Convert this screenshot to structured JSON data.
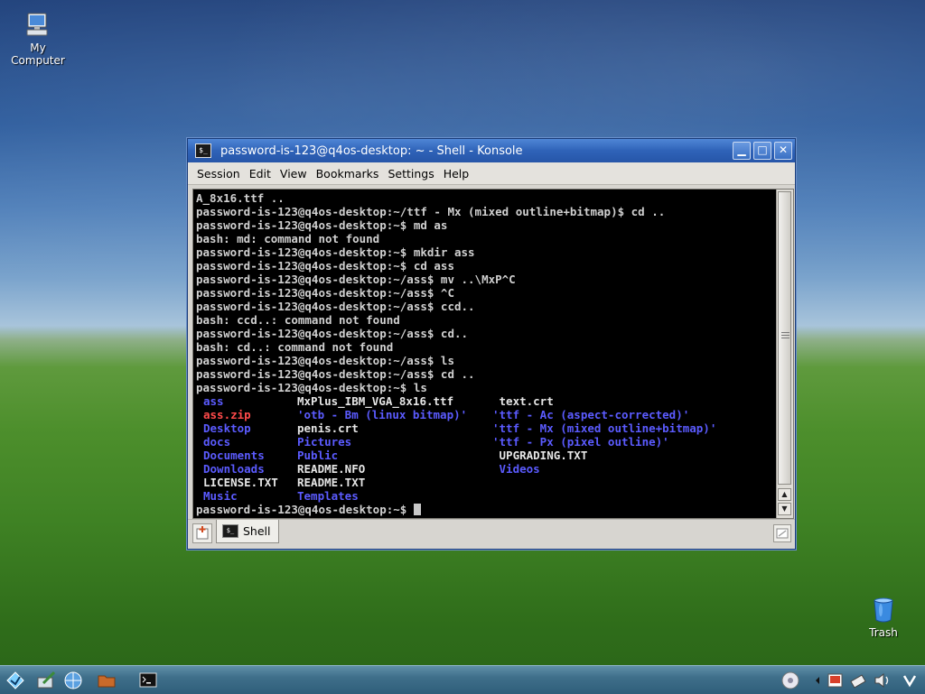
{
  "desktop": {
    "icons": [
      {
        "label_line1": "My",
        "label_line2": "Computer",
        "icon": "computer-icon"
      },
      {
        "label": "Trash",
        "icon": "trash-icon"
      }
    ]
  },
  "window": {
    "title": "password-is-123@q4os-desktop: ~ - Shell - Konsole",
    "buttons": {
      "minimize": "▁",
      "maximize": "□",
      "close": "✕"
    },
    "menu": [
      "Session",
      "Edit",
      "View",
      "Bookmarks",
      "Settings",
      "Help"
    ]
  },
  "terminal": {
    "lines": [
      "A_8x16.ttf ..",
      "password-is-123@q4os-desktop:~/ttf - Mx (mixed outline+bitmap)$ cd ..",
      "password-is-123@q4os-desktop:~$ md as",
      "bash: md: command not found",
      "password-is-123@q4os-desktop:~$ mkdir ass",
      "password-is-123@q4os-desktop:~$ cd ass",
      "password-is-123@q4os-desktop:~/ass$ mv ..\\MxP^C",
      "password-is-123@q4os-desktop:~/ass$ ^C",
      "password-is-123@q4os-desktop:~/ass$ ccd..",
      "bash: ccd..: command not found",
      "password-is-123@q4os-desktop:~/ass$ cd..",
      "bash: cd..: command not found",
      "password-is-123@q4os-desktop:~/ass$ ls",
      "password-is-123@q4os-desktop:~/ass$ cd ..",
      "password-is-123@q4os-desktop:~$ ls"
    ],
    "ls_rows": [
      [
        {
          "t": "ass",
          "c": "blue"
        },
        {
          "t": "MxPlus_IBM_VGA_8x16.ttf",
          "c": "white"
        },
        {
          "t": " text.crt",
          "c": "white"
        }
      ],
      [
        {
          "t": "ass.zip",
          "c": "red"
        },
        {
          "t": "'otb - Bm (linux bitmap)'",
          "c": "blue"
        },
        {
          "t": "'ttf - Ac (aspect-corrected)'",
          "c": "blue"
        }
      ],
      [
        {
          "t": "Desktop",
          "c": "blue"
        },
        {
          "t": "penis.crt",
          "c": "white"
        },
        {
          "t": "'ttf - Mx (mixed outline+bitmap)'",
          "c": "blue"
        }
      ],
      [
        {
          "t": "docs",
          "c": "blue"
        },
        {
          "t": "Pictures",
          "c": "blue"
        },
        {
          "t": "'ttf - Px (pixel outline)'",
          "c": "blue"
        }
      ],
      [
        {
          "t": "Documents",
          "c": "blue"
        },
        {
          "t": "Public",
          "c": "blue"
        },
        {
          "t": " UPGRADING.TXT",
          "c": "white"
        }
      ],
      [
        {
          "t": "Downloads",
          "c": "blue"
        },
        {
          "t": "README.NFO",
          "c": "white"
        },
        {
          "t": " Videos",
          "c": "blue"
        }
      ],
      [
        {
          "t": "LICENSE.TXT",
          "c": "white"
        },
        {
          "t": "README.TXT",
          "c": "white"
        },
        {
          "t": "",
          "c": "white"
        }
      ],
      [
        {
          "t": "Music",
          "c": "blue"
        },
        {
          "t": "Templates",
          "c": "blue"
        },
        {
          "t": "",
          "c": "white"
        }
      ]
    ],
    "prompt": "password-is-123@q4os-desktop:~$ "
  },
  "tabs": [
    {
      "label": "Shell"
    }
  ],
  "taskbar": {
    "items": [
      "start-icon",
      "desktop-tools-icon",
      "network-icon",
      "file-manager-icon",
      "konsole-icon"
    ],
    "tray": [
      "cd-icon",
      "arrow-left-icon",
      "photo-icon",
      "network-tray-icon",
      "volume-icon",
      "q4os-logo-icon"
    ]
  },
  "colors": {
    "ls_blue": "#5b5bff",
    "ls_red": "#ff4a4a",
    "titlebar": "#2f63b8"
  }
}
